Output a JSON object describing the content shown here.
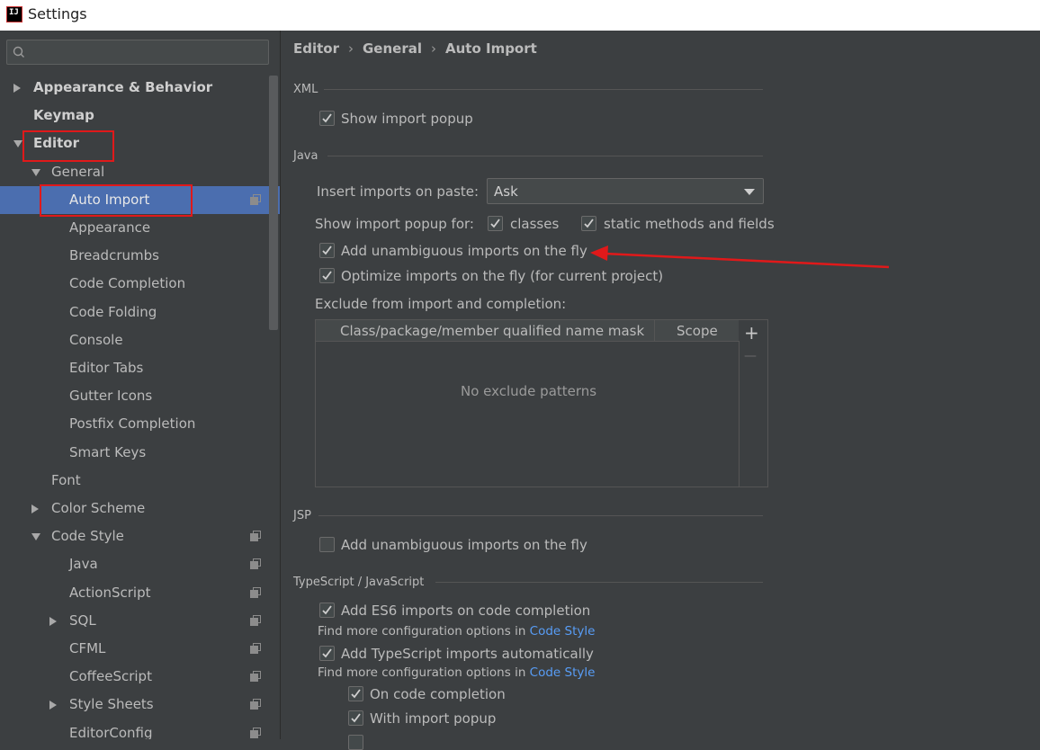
{
  "window": {
    "title": "Settings",
    "app_icon_text": "IJ"
  },
  "search": {
    "placeholder": ""
  },
  "tree": [
    {
      "label": "Appearance & Behavior",
      "level": 0,
      "arrow": "right",
      "bold": true
    },
    {
      "label": "Keymap",
      "level": 0,
      "arrow": "none",
      "bold": true
    },
    {
      "label": "Editor",
      "level": 0,
      "arrow": "down",
      "bold": true,
      "highlighted": true
    },
    {
      "label": "General",
      "level": 1,
      "arrow": "down"
    },
    {
      "label": "Auto Import",
      "level": 2,
      "selected": true,
      "highlighted": true,
      "copy_icon": true
    },
    {
      "label": "Appearance",
      "level": 2
    },
    {
      "label": "Breadcrumbs",
      "level": 2
    },
    {
      "label": "Code Completion",
      "level": 2
    },
    {
      "label": "Code Folding",
      "level": 2
    },
    {
      "label": "Console",
      "level": 2
    },
    {
      "label": "Editor Tabs",
      "level": 2
    },
    {
      "label": "Gutter Icons",
      "level": 2
    },
    {
      "label": "Postfix Completion",
      "level": 2
    },
    {
      "label": "Smart Keys",
      "level": 2
    },
    {
      "label": "Font",
      "level": 1
    },
    {
      "label": "Color Scheme",
      "level": 1,
      "arrow": "right"
    },
    {
      "label": "Code Style",
      "level": 1,
      "arrow": "down",
      "copy_icon": true
    },
    {
      "label": "Java",
      "level": 2,
      "copy_icon": true
    },
    {
      "label": "ActionScript",
      "level": 2,
      "copy_icon": true
    },
    {
      "label": "SQL",
      "level": 2,
      "arrow": "right",
      "copy_icon": true
    },
    {
      "label": "CFML",
      "level": 2,
      "copy_icon": true
    },
    {
      "label": "CoffeeScript",
      "level": 2,
      "copy_icon": true
    },
    {
      "label": "Style Sheets",
      "level": 2,
      "arrow": "right",
      "copy_icon": true
    },
    {
      "label": "EditorConfig",
      "level": 2,
      "copy_icon": true
    }
  ],
  "breadcrumb": [
    "Editor",
    "General",
    "Auto Import"
  ],
  "sections": {
    "xml": "XML",
    "java": "Java",
    "jsp": "JSP",
    "ts": "TypeScript / JavaScript"
  },
  "xml": {
    "show_import_popup": {
      "label": "Show import popup",
      "checked": true
    }
  },
  "java": {
    "insert_on_paste_label": "Insert imports on paste:",
    "insert_on_paste_value": "Ask",
    "show_popup_for_label": "Show import popup for:",
    "classes": {
      "label": "classes",
      "checked": true
    },
    "static": {
      "label": "static methods and fields",
      "checked": true
    },
    "add_unambiguous": {
      "label": "Add unambiguous imports on the fly",
      "checked": true
    },
    "optimize": {
      "label": "Optimize imports on the fly (for current project)",
      "checked": true
    },
    "exclude_label": "Exclude from import and completion:",
    "table": {
      "col1": "Class/package/member qualified name mask",
      "col2": "Scope",
      "empty": "No exclude patterns",
      "add": "+",
      "remove": "—"
    }
  },
  "jsp": {
    "add_unambiguous": {
      "label": "Add unambiguous imports on the fly",
      "checked": false
    }
  },
  "ts": {
    "es6": {
      "label": "Add ES6 imports on code completion",
      "checked": true
    },
    "find_more_1": "Find more configuration options in",
    "code_style_link_1": "Code Style",
    "ts_auto": {
      "label": "Add TypeScript imports automatically",
      "checked": true
    },
    "find_more_2": "Find more configuration options in",
    "code_style_link_2": "Code Style",
    "on_completion": {
      "label": "On code completion",
      "checked": true
    },
    "with_popup": {
      "label": "With import popup",
      "checked": true
    }
  },
  "colors": {
    "selection": "#4b6eaf",
    "highlight_box": "#e0191a",
    "arrow": "#e0191a",
    "link": "#589df6"
  }
}
